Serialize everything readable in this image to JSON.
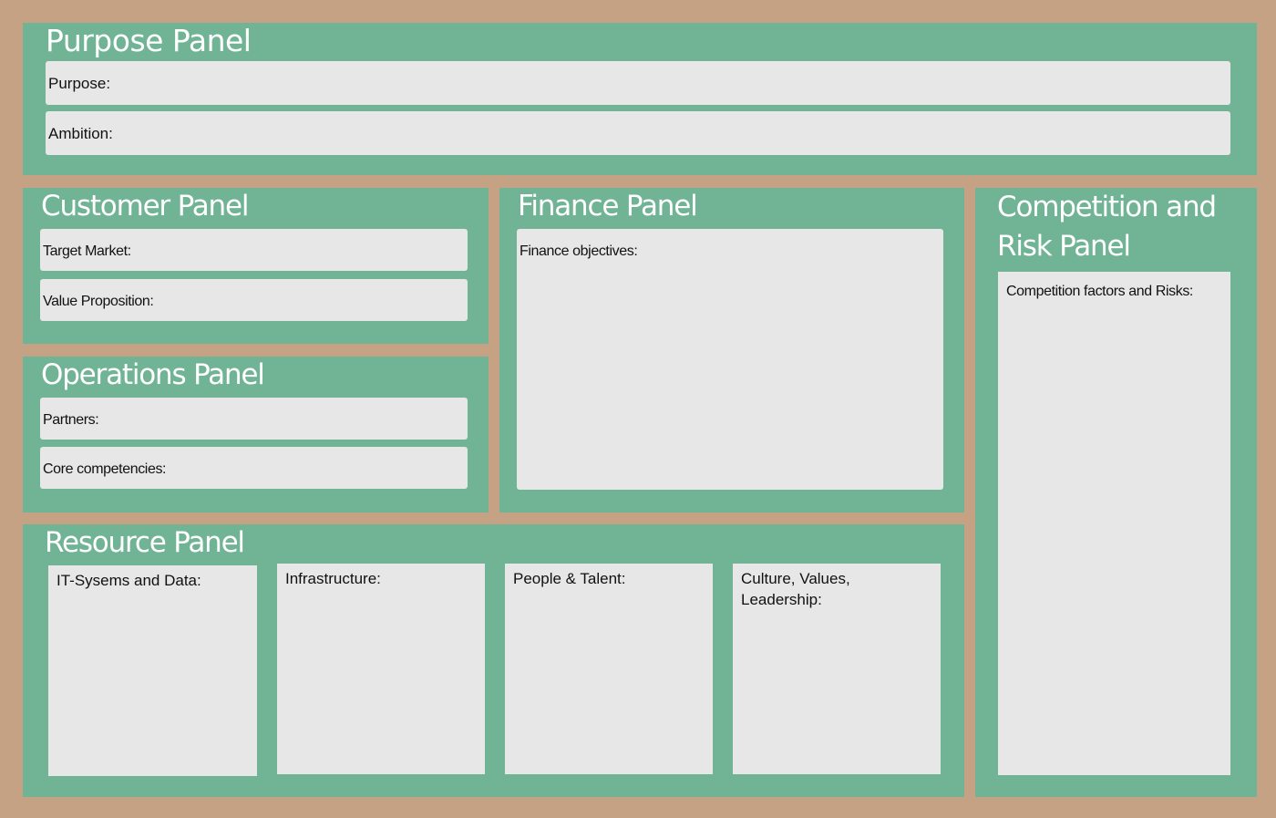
{
  "purpose_panel": {
    "title": "Purpose Panel",
    "purpose_label": "Purpose:",
    "ambition_label": "Ambition:"
  },
  "customer_panel": {
    "title": "Customer Panel",
    "target_market_label": "Target Market:",
    "value_proposition_label": "Value Proposition:"
  },
  "operations_panel": {
    "title": "Operations Panel",
    "partners_label": "Partners:",
    "core_competencies_label": "Core competencies:"
  },
  "finance_panel": {
    "title": "Finance Panel",
    "finance_objectives_label": "Finance objectives:"
  },
  "competition_panel": {
    "title": "Competition and Risk Panel",
    "competition_label": "Competition factors and Risks:"
  },
  "resource_panel": {
    "title": "Resource Panel",
    "it_label": "IT-Sysems and Data:",
    "infrastructure_label": "Infrastructure:",
    "people_label": "People & Talent:",
    "culture_label": "Culture, Values, Leadership:"
  },
  "colors": {
    "background": "#c6a284",
    "panel": "#70b495",
    "field": "#e7e7e7",
    "title_text": "#ffffff"
  }
}
